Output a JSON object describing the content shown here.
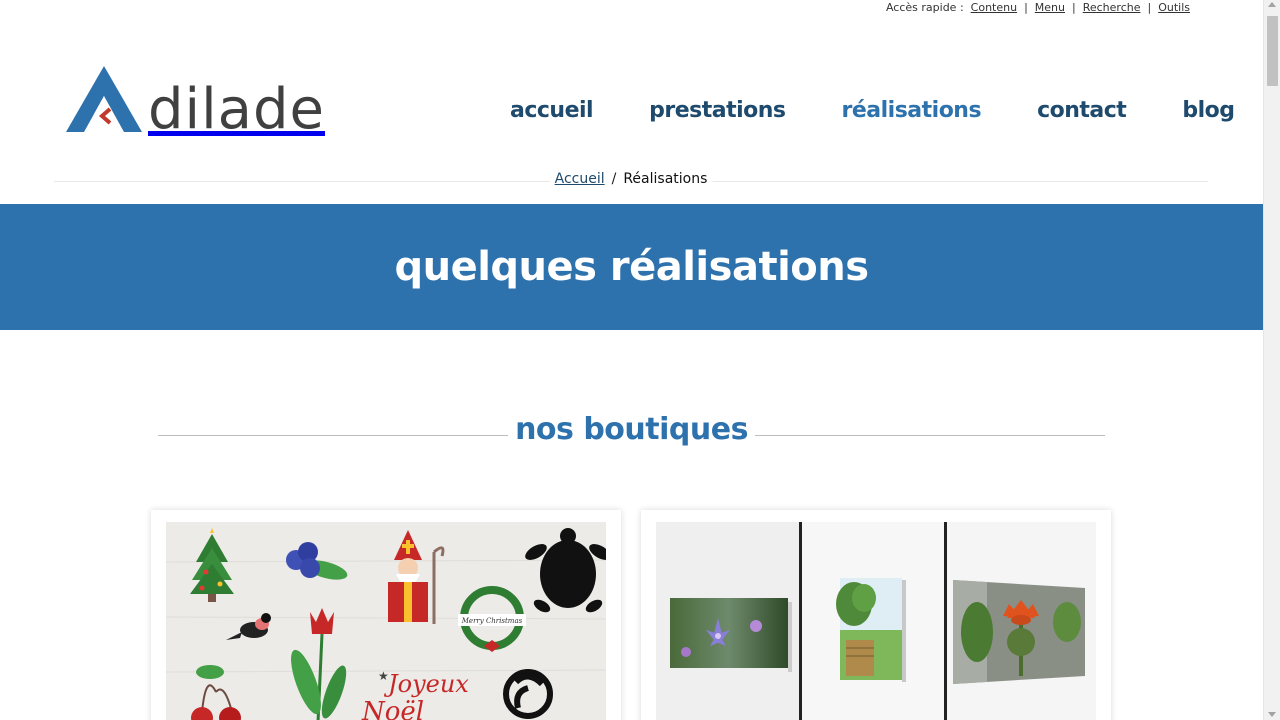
{
  "quick_access": {
    "label": "Accès rapide :",
    "links": [
      "Contenu",
      "Menu",
      "Recherche",
      "Outils"
    ]
  },
  "logo": {
    "text": "dilade"
  },
  "nav": [
    {
      "label": "accueil",
      "active": false
    },
    {
      "label": "prestations",
      "active": false
    },
    {
      "label": "réalisations",
      "active": true
    },
    {
      "label": "contact",
      "active": false
    },
    {
      "label": "blog",
      "active": false
    }
  ],
  "breadcrumb": {
    "home": "Accueil",
    "separator": "/",
    "current": "Réalisations"
  },
  "banner": {
    "title": "quelques réalisations"
  },
  "section": {
    "title": "nos boutiques"
  },
  "cards": {
    "card1": {
      "greeting_line1": "Joyeux",
      "greeting_line2": "Noël",
      "wreath_text": "Merry Christmas"
    }
  },
  "colors": {
    "brand_dark": "#1e4a6d",
    "brand_blue": "#2d72ad",
    "logo_red": "#c0392b"
  }
}
